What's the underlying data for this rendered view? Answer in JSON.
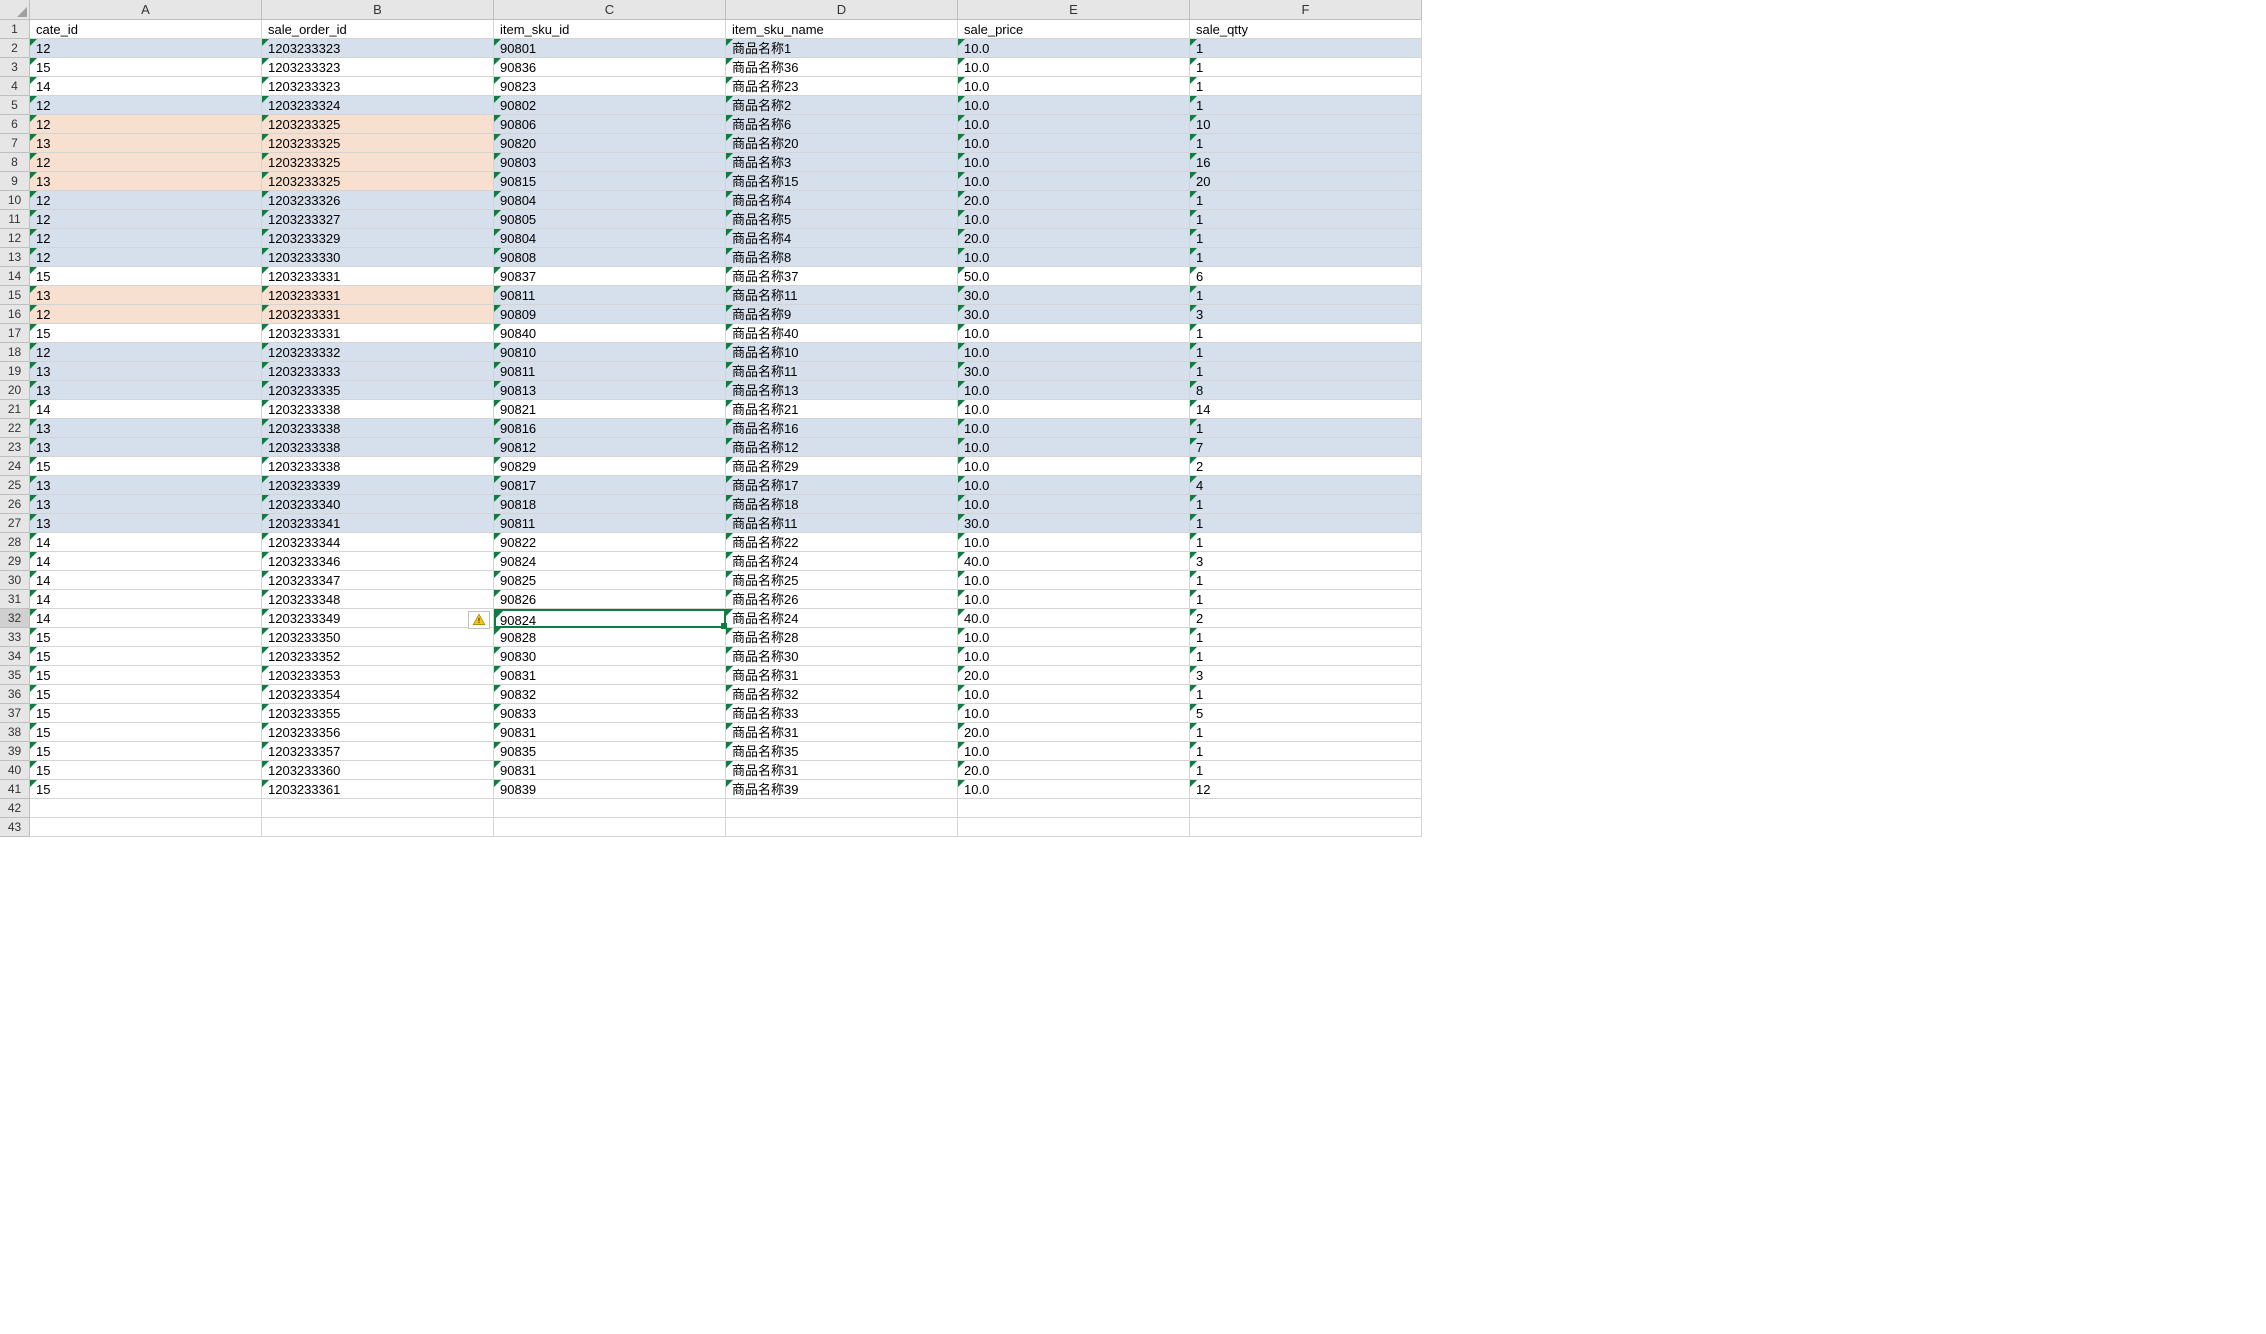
{
  "columns": [
    "A",
    "B",
    "C",
    "D",
    "E",
    "F"
  ],
  "headers": {
    "A": "cate_id",
    "B": "sale_order_id",
    "C": "item_sku_id",
    "D": "item_sku_name",
    "E": "sale_price",
    "F": "sale_qtty"
  },
  "selected_cell": "C32",
  "rows": [
    {
      "n": 1,
      "type": "header"
    },
    {
      "n": 2,
      "hl": "blue",
      "A": "12",
      "B": "1203233323",
      "C": "90801",
      "D": "商品名称1",
      "E": "10.0",
      "F": "1"
    },
    {
      "n": 3,
      "hl": "",
      "A": "15",
      "B": "1203233323",
      "C": "90836",
      "D": "商品名称36",
      "E": "10.0",
      "F": "1"
    },
    {
      "n": 4,
      "hl": "",
      "A": "14",
      "B": "1203233323",
      "C": "90823",
      "D": "商品名称23",
      "E": "10.0",
      "F": "1"
    },
    {
      "n": 5,
      "hl": "blue",
      "A": "12",
      "B": "1203233324",
      "C": "90802",
      "D": "商品名称2",
      "E": "10.0",
      "F": "1"
    },
    {
      "n": 6,
      "hl": "orange",
      "A": "12",
      "B": "1203233325",
      "C": "90806",
      "D": "商品名称6",
      "E": "10.0",
      "F": "10"
    },
    {
      "n": 7,
      "hl": "orange",
      "A": "13",
      "B": "1203233325",
      "C": "90820",
      "D": "商品名称20",
      "E": "10.0",
      "F": "1"
    },
    {
      "n": 8,
      "hl": "orange",
      "A": "12",
      "B": "1203233325",
      "C": "90803",
      "D": "商品名称3",
      "E": "10.0",
      "F": "16"
    },
    {
      "n": 9,
      "hl": "orange",
      "A": "13",
      "B": "1203233325",
      "C": "90815",
      "D": "商品名称15",
      "E": "10.0",
      "F": "20"
    },
    {
      "n": 10,
      "hl": "blue",
      "A": "12",
      "B": "1203233326",
      "C": "90804",
      "D": "商品名称4",
      "E": "20.0",
      "F": "1"
    },
    {
      "n": 11,
      "hl": "blue",
      "A": "12",
      "B": "1203233327",
      "C": "90805",
      "D": "商品名称5",
      "E": "10.0",
      "F": "1"
    },
    {
      "n": 12,
      "hl": "blue",
      "A": "12",
      "B": "1203233329",
      "C": "90804",
      "D": "商品名称4",
      "E": "20.0",
      "F": "1"
    },
    {
      "n": 13,
      "hl": "blue",
      "A": "12",
      "B": "1203233330",
      "C": "90808",
      "D": "商品名称8",
      "E": "10.0",
      "F": "1"
    },
    {
      "n": 14,
      "hl": "",
      "A": "15",
      "B": "1203233331",
      "C": "90837",
      "D": "商品名称37",
      "E": "50.0",
      "F": "6"
    },
    {
      "n": 15,
      "hl": "orange",
      "A": "13",
      "B": "1203233331",
      "C": "90811",
      "D": "商品名称11",
      "E": "30.0",
      "F": "1"
    },
    {
      "n": 16,
      "hl": "orange",
      "A": "12",
      "B": "1203233331",
      "C": "90809",
      "D": "商品名称9",
      "E": "30.0",
      "F": "3"
    },
    {
      "n": 17,
      "hl": "",
      "A": "15",
      "B": "1203233331",
      "C": "90840",
      "D": "商品名称40",
      "E": "10.0",
      "F": "1"
    },
    {
      "n": 18,
      "hl": "blue",
      "A": "12",
      "B": "1203233332",
      "C": "90810",
      "D": "商品名称10",
      "E": "10.0",
      "F": "1"
    },
    {
      "n": 19,
      "hl": "blue",
      "A": "13",
      "B": "1203233333",
      "C": "90811",
      "D": "商品名称11",
      "E": "30.0",
      "F": "1"
    },
    {
      "n": 20,
      "hl": "blue",
      "A": "13",
      "B": "1203233335",
      "C": "90813",
      "D": "商品名称13",
      "E": "10.0",
      "F": "8"
    },
    {
      "n": 21,
      "hl": "",
      "A": "14",
      "B": "1203233338",
      "C": "90821",
      "D": "商品名称21",
      "E": "10.0",
      "F": "14"
    },
    {
      "n": 22,
      "hl": "blue",
      "A": "13",
      "B": "1203233338",
      "C": "90816",
      "D": "商品名称16",
      "E": "10.0",
      "F": "1"
    },
    {
      "n": 23,
      "hl": "blue",
      "A": "13",
      "B": "1203233338",
      "C": "90812",
      "D": "商品名称12",
      "E": "10.0",
      "F": "7"
    },
    {
      "n": 24,
      "hl": "",
      "A": "15",
      "B": "1203233338",
      "C": "90829",
      "D": "商品名称29",
      "E": "10.0",
      "F": "2"
    },
    {
      "n": 25,
      "hl": "blue",
      "A": "13",
      "B": "1203233339",
      "C": "90817",
      "D": "商品名称17",
      "E": "10.0",
      "F": "4"
    },
    {
      "n": 26,
      "hl": "blue",
      "A": "13",
      "B": "1203233340",
      "C": "90818",
      "D": "商品名称18",
      "E": "10.0",
      "F": "1"
    },
    {
      "n": 27,
      "hl": "blue",
      "A": "13",
      "B": "1203233341",
      "C": "90811",
      "D": "商品名称11",
      "E": "30.0",
      "F": "1"
    },
    {
      "n": 28,
      "hl": "",
      "A": "14",
      "B": "1203233344",
      "C": "90822",
      "D": "商品名称22",
      "E": "10.0",
      "F": "1"
    },
    {
      "n": 29,
      "hl": "",
      "A": "14",
      "B": "1203233346",
      "C": "90824",
      "D": "商品名称24",
      "E": "40.0",
      "F": "3"
    },
    {
      "n": 30,
      "hl": "",
      "A": "14",
      "B": "1203233347",
      "C": "90825",
      "D": "商品名称25",
      "E": "10.0",
      "F": "1"
    },
    {
      "n": 31,
      "hl": "",
      "A": "14",
      "B": "1203233348",
      "C": "90826",
      "D": "商品名称26",
      "E": "10.0",
      "F": "1"
    },
    {
      "n": 32,
      "hl": "",
      "A": "14",
      "B": "1203233349",
      "C": "90824",
      "D": "商品名称24",
      "E": "40.0",
      "F": "2"
    },
    {
      "n": 33,
      "hl": "",
      "A": "15",
      "B": "1203233350",
      "C": "90828",
      "D": "商品名称28",
      "E": "10.0",
      "F": "1"
    },
    {
      "n": 34,
      "hl": "",
      "A": "15",
      "B": "1203233352",
      "C": "90830",
      "D": "商品名称30",
      "E": "10.0",
      "F": "1"
    },
    {
      "n": 35,
      "hl": "",
      "A": "15",
      "B": "1203233353",
      "C": "90831",
      "D": "商品名称31",
      "E": "20.0",
      "F": "3"
    },
    {
      "n": 36,
      "hl": "",
      "A": "15",
      "B": "1203233354",
      "C": "90832",
      "D": "商品名称32",
      "E": "10.0",
      "F": "1"
    },
    {
      "n": 37,
      "hl": "",
      "A": "15",
      "B": "1203233355",
      "C": "90833",
      "D": "商品名称33",
      "E": "10.0",
      "F": "5"
    },
    {
      "n": 38,
      "hl": "",
      "A": "15",
      "B": "1203233356",
      "C": "90831",
      "D": "商品名称31",
      "E": "20.0",
      "F": "1"
    },
    {
      "n": 39,
      "hl": "",
      "A": "15",
      "B": "1203233357",
      "C": "90835",
      "D": "商品名称35",
      "E": "10.0",
      "F": "1"
    },
    {
      "n": 40,
      "hl": "",
      "A": "15",
      "B": "1203233360",
      "C": "90831",
      "D": "商品名称31",
      "E": "20.0",
      "F": "1"
    },
    {
      "n": 41,
      "hl": "",
      "A": "15",
      "B": "1203233361",
      "C": "90839",
      "D": "商品名称39",
      "E": "10.0",
      "F": "12"
    },
    {
      "n": 42,
      "empty": true
    },
    {
      "n": 43,
      "empty": true
    }
  ]
}
